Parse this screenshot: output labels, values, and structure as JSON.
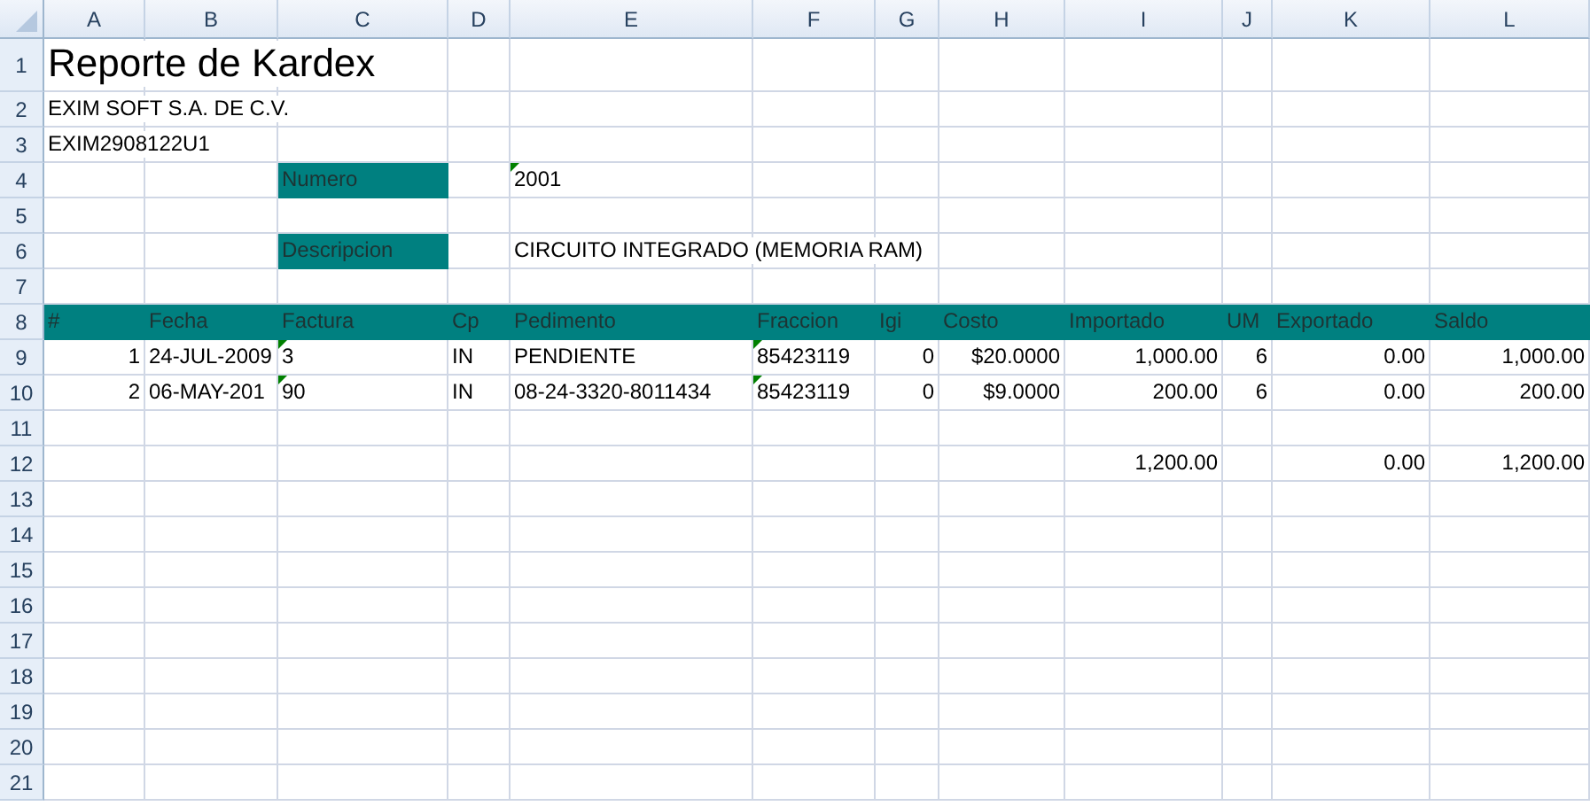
{
  "columns": [
    "A",
    "B",
    "C",
    "D",
    "E",
    "F",
    "G",
    "H",
    "I",
    "J",
    "K",
    "L"
  ],
  "rows": [
    {
      "number": "1",
      "cells": [
        {
          "text": "Reporte de Kardex",
          "kind": "title"
        }
      ]
    },
    {
      "number": "2",
      "cells": [
        {
          "text": "EXIM SOFT S.A. DE C.V."
        }
      ]
    },
    {
      "number": "3",
      "cells": [
        {
          "text": "EXIM2908122U1"
        }
      ]
    },
    {
      "number": "4",
      "cells": [
        null,
        null,
        {
          "text": "Numero",
          "fill": true
        },
        null,
        {
          "text": "2001",
          "flag": true
        }
      ]
    },
    {
      "number": "5"
    },
    {
      "number": "6",
      "cells": [
        null,
        null,
        {
          "text": "Descripcion",
          "fill": true
        },
        null,
        {
          "text": "CIRCUITO INTEGRADO (MEMORIA RAM)"
        }
      ]
    },
    {
      "number": "7"
    },
    {
      "number": "8",
      "cells": [
        {
          "text": "#",
          "fill": true
        },
        {
          "text": "Fecha",
          "fill": true
        },
        {
          "text": "Factura",
          "fill": true
        },
        {
          "text": "Cp",
          "fill": true
        },
        {
          "text": "Pedimento",
          "fill": true
        },
        {
          "text": "Fraccion",
          "fill": true
        },
        {
          "text": "Igi",
          "fill": true
        },
        {
          "text": "Costo",
          "fill": true
        },
        {
          "text": "Importado",
          "fill": true
        },
        {
          "text": "UM",
          "fill": true
        },
        {
          "text": "Exportado",
          "fill": true
        },
        {
          "text": "Saldo",
          "fill": true
        }
      ]
    },
    {
      "number": "9",
      "cells": [
        {
          "text": "1",
          "kind": "number"
        },
        {
          "text": "24-JUL-2009"
        },
        {
          "text": "3",
          "flag": true
        },
        {
          "text": "IN"
        },
        {
          "text": "PENDIENTE"
        },
        {
          "text": "85423119",
          "flag": true
        },
        {
          "text": "0",
          "kind": "number"
        },
        {
          "text": "$20.0000",
          "kind": "number"
        },
        {
          "text": "1,000.00",
          "kind": "number"
        },
        {
          "text": "6",
          "kind": "number"
        },
        {
          "text": "0.00",
          "kind": "number"
        },
        {
          "text": "1,000.00",
          "kind": "number"
        }
      ]
    },
    {
      "number": "10",
      "cells": [
        {
          "text": "2",
          "kind": "number"
        },
        {
          "text": "06-MAY-201"
        },
        {
          "text": "90",
          "flag": true
        },
        {
          "text": "IN"
        },
        {
          "text": "08-24-3320-8011434"
        },
        {
          "text": "85423119",
          "flag": true
        },
        {
          "text": "0",
          "kind": "number"
        },
        {
          "text": "$9.0000",
          "kind": "number"
        },
        {
          "text": "200.00",
          "kind": "number"
        },
        {
          "text": "6",
          "kind": "number"
        },
        {
          "text": "0.00",
          "kind": "number"
        },
        {
          "text": "200.00",
          "kind": "number"
        }
      ]
    },
    {
      "number": "11"
    },
    {
      "number": "12",
      "cells": [
        null,
        null,
        null,
        null,
        null,
        null,
        null,
        null,
        {
          "text": "1,200.00",
          "kind": "number"
        },
        null,
        {
          "text": "0.00",
          "kind": "number"
        },
        {
          "text": "1,200.00",
          "kind": "number"
        }
      ]
    },
    {
      "number": "13"
    },
    {
      "number": "14"
    },
    {
      "number": "15"
    },
    {
      "number": "16"
    },
    {
      "number": "17"
    },
    {
      "number": "18"
    },
    {
      "number": "19"
    },
    {
      "number": "20"
    },
    {
      "number": "21"
    }
  ]
}
